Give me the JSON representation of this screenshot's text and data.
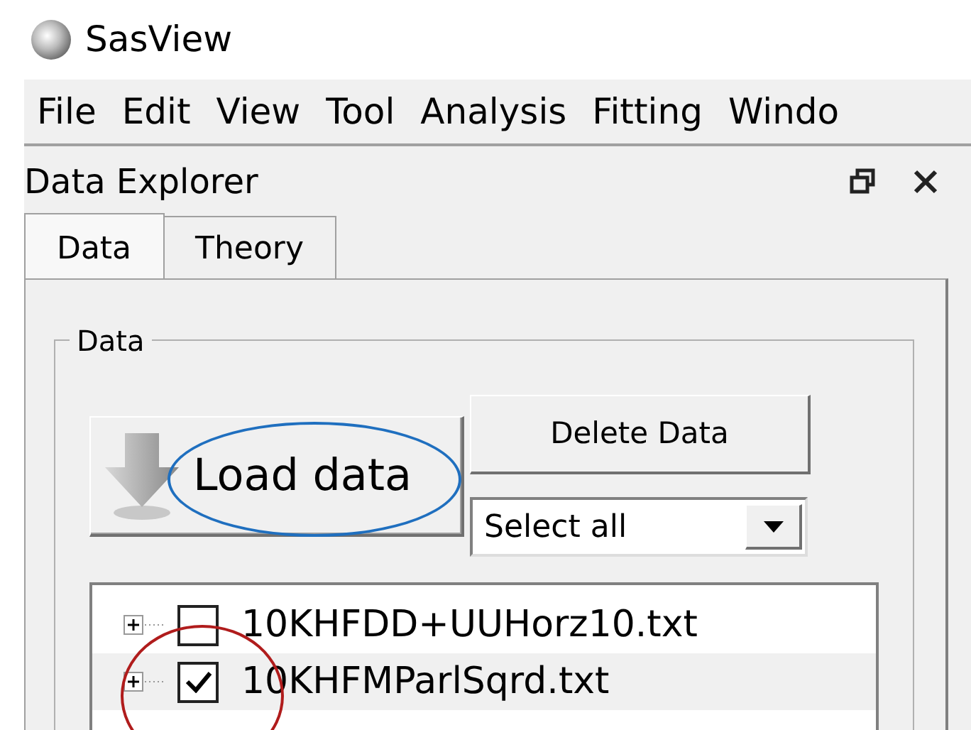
{
  "window": {
    "title": "SasView"
  },
  "menu": [
    "File",
    "Edit",
    "View",
    "Tool",
    "Analysis",
    "Fitting",
    "Windo"
  ],
  "dock": {
    "title": "Data Explorer"
  },
  "tabs": [
    {
      "label": "Data",
      "selected": true
    },
    {
      "label": "Theory",
      "selected": false
    }
  ],
  "group": {
    "title": "Data"
  },
  "buttons": {
    "load": "Load data",
    "delete": "Delete Data"
  },
  "select": {
    "value": "Select all"
  },
  "files": [
    {
      "name": "10KHFDD+UUHorz10.txt",
      "checked": false,
      "selected": false
    },
    {
      "name": "10KHFMParlSqrd.txt",
      "checked": true,
      "selected": true
    }
  ],
  "annotations": [
    {
      "color": "#1f6fbf"
    },
    {
      "color": "#b01c1c"
    }
  ]
}
